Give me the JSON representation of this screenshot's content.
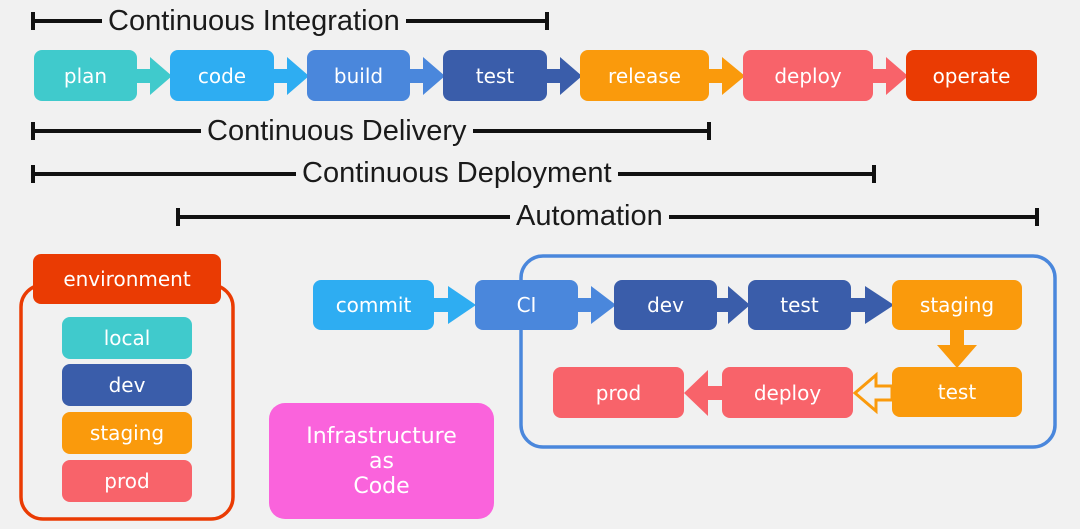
{
  "colors": {
    "background": "#f1f1f1",
    "plan": "#40cacc",
    "code": "#2eadf2",
    "build": "#4a87dc",
    "test": "#3a5daa",
    "release": "#fa9a0c",
    "deploy": "#f8636a",
    "operate": "#ea3b03",
    "iac": "#fa63dc",
    "env_border": "#ea3b03",
    "pipeline_border": "#4a87dc"
  },
  "spans": [
    {
      "id": "ci",
      "label": "Continuous Integration"
    },
    {
      "id": "cdelivery",
      "label": "Continuous Delivery"
    },
    {
      "id": "cdeployment",
      "label": "Continuous Deployment"
    },
    {
      "id": "automation",
      "label": "Automation"
    }
  ],
  "stages": [
    {
      "label": "plan"
    },
    {
      "label": "code"
    },
    {
      "label": "build"
    },
    {
      "label": "test"
    },
    {
      "label": "release"
    },
    {
      "label": "deploy"
    },
    {
      "label": "operate"
    }
  ],
  "environment": {
    "title": "environment",
    "items": [
      {
        "label": "local"
      },
      {
        "label": "dev"
      },
      {
        "label": "staging"
      },
      {
        "label": "prod"
      }
    ]
  },
  "iac": {
    "line1": "Infrastructure",
    "line2": "as",
    "line3": "Code"
  },
  "pipeline": {
    "commit": "commit",
    "ci": "CI",
    "dev": "dev",
    "test": "test",
    "staging": "staging",
    "test2": "test",
    "deploy": "deploy",
    "prod": "prod"
  }
}
